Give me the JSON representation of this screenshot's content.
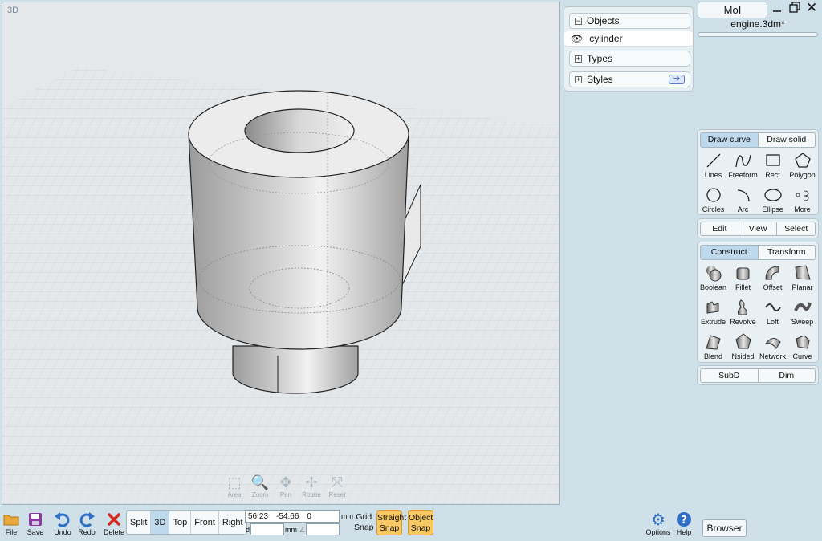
{
  "viewport": {
    "label": "3D"
  },
  "nav_tools": [
    {
      "name": "area",
      "label": "Area",
      "glyph": "⬚"
    },
    {
      "name": "zoom",
      "label": "Zoom",
      "glyph": "🔍"
    },
    {
      "name": "pan",
      "label": "Pan",
      "glyph": "✥"
    },
    {
      "name": "rotate",
      "label": "Rotate",
      "glyph": "✢"
    },
    {
      "name": "reset",
      "label": "Reset",
      "glyph": "⤧"
    }
  ],
  "objects_panel": {
    "objects_label": "Objects",
    "objects_toggle": "−",
    "selected_object": "cylinder",
    "types_label": "Types",
    "types_toggle": "+",
    "styles_label": "Styles",
    "styles_toggle": "+",
    "styles_arrow": "➔"
  },
  "app": {
    "title": "MoI",
    "filename": "engine.3dm*"
  },
  "draw_tabs": {
    "draw_curve": "Draw curve",
    "draw_solid": "Draw solid"
  },
  "draw_commands": [
    {
      "name": "lines",
      "label": "Lines"
    },
    {
      "name": "freeform",
      "label": "Freeform"
    },
    {
      "name": "rect",
      "label": "Rect"
    },
    {
      "name": "polygon",
      "label": "Polygon"
    },
    {
      "name": "circles",
      "label": "Circles"
    },
    {
      "name": "arc",
      "label": "Arc"
    },
    {
      "name": "ellipse",
      "label": "Ellipse"
    },
    {
      "name": "more",
      "label": "More"
    }
  ],
  "edit_row": {
    "edit": "Edit",
    "view": "View",
    "select": "Select"
  },
  "construct_tabs": {
    "construct": "Construct",
    "transform": "Transform"
  },
  "construct_commands": [
    {
      "name": "boolean",
      "label": "Boolean"
    },
    {
      "name": "fillet",
      "label": "Fillet"
    },
    {
      "name": "offset",
      "label": "Offset"
    },
    {
      "name": "planar",
      "label": "Planar"
    },
    {
      "name": "extrude",
      "label": "Extrude"
    },
    {
      "name": "revolve",
      "label": "Revolve"
    },
    {
      "name": "loft",
      "label": "Loft"
    },
    {
      "name": "sweep",
      "label": "Sweep"
    },
    {
      "name": "blend",
      "label": "Blend"
    },
    {
      "name": "nsided",
      "label": "Nsided"
    },
    {
      "name": "network",
      "label": "Network"
    },
    {
      "name": "curve",
      "label": "Curve"
    }
  ],
  "subd_row": {
    "subd": "SubD",
    "dim": "Dim"
  },
  "bottom": {
    "file": "File",
    "save": "Save",
    "undo": "Undo",
    "redo": "Redo",
    "delete": "Delete",
    "views": [
      "Split",
      "3D",
      "Top",
      "Front",
      "Right"
    ],
    "active_view": "3D",
    "coords": {
      "x": "56.23",
      "y": "-54.66",
      "z": "0"
    },
    "coord_unit": "mm",
    "dist_label": "d",
    "dist_unit": "mm",
    "angle_glyph": "∠",
    "grid_snap": [
      "Grid",
      "Snap"
    ],
    "straight_snap": [
      "Straight",
      "Snap"
    ],
    "object_snap": [
      "Object",
      "Snap"
    ],
    "options": "Options",
    "help": "Help",
    "browser": "Browser"
  },
  "colors": {
    "accent": "#bfd9ec",
    "snap_on": "#f8c862",
    "background": "#cfe0e8"
  }
}
